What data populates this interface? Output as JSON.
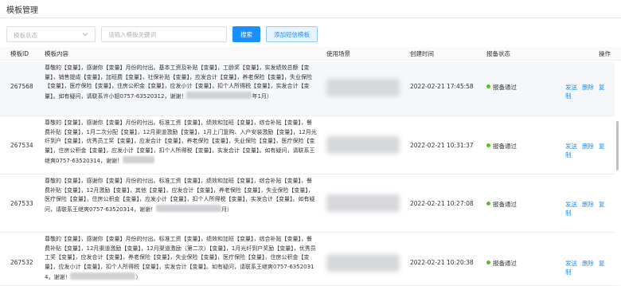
{
  "page_title": "模板管理",
  "toolbar": {
    "status_placeholder": "模板状态",
    "search_placeholder": "请输入模板关键词",
    "search_button": "搜索",
    "add_button": "添加短信模板"
  },
  "table": {
    "headers": [
      "模板ID",
      "模板内容",
      "使用场景",
      "创建时间",
      "报备状态",
      "操作"
    ],
    "rows": [
      {
        "id": "267568",
        "content_parts": [
          "尊敬的【变量】，感谢你【变量】月份的付出。基本工资及补贴【变量】，工龄奖【变量】，实发绩效总额【变量】，销售提成【变量】，加班费【变量】，社保补贴【变量】，应发合计【变量】，养老保险【变量】，失业保险【变量】，医疗保险【变量】，住房公积金【变量】，应发小计【变量】，扣个人所得税【变量】，实发合计【变量】。如有疑问，请联系许小姐0757-63520312，谢谢！",
          "年1月）"
        ],
        "time": "2022-02-21 17:45:58",
        "status": "报备通过"
      },
      {
        "id": "267534",
        "content_parts": [
          "尊敬的【变量】，感谢你【变量】月份的付出。标准工资【变量】，绩效和加班【变量】，综合补贴【变量】，餐费补贴【变量】，1月二次分配【变量】，12月渠道激励【变量】，1月上门复购、入户安装激励【变量】，12月光纤到户【变量】，优秀员工奖【变量】，应发合计【变量】，养老保险【变量】，失业保险【变量】，医疗保险【变量】，住房公积金【变量】，应发小计【变量】，扣个人所得税【变量】，实发合计【变量】。如有疑问，请联系王继爽0757-63520314，谢谢！",
          ""
        ],
        "time": "2022-02-21 10:31:37",
        "status": "报备通过"
      },
      {
        "id": "267533",
        "content_parts": [
          "尊敬的【变量】，感谢你【变量】月份的付出。标准工资【变量】，绩效和加班【变量】，综合补贴【变量】，餐费补贴【变量】，12月激励【变量】，其他【变量】，应发合计【变量】，养老保险【变量】，失业保险【变量】，医疗保险【变量】，住房公积金【变量】，应发小计【变量】，扣个人所得税【变量】，实发合计【变量】。如有疑问，请联系王继爽0757-63520314，谢谢！",
          "月）"
        ],
        "time": "2022-02-21 10:27:08",
        "status": "报备通过"
      },
      {
        "id": "267532",
        "content_parts": [
          "尊敬的【变量】，感谢你【变量】月份的付出。标准工资【变量】，绩效和加班【变量】，综合补贴【变量】，餐费补贴【变量】，12月渠道激励【变量】，12月渠道激励（第二次）【变量】，1月光纤到户奖励【变量】，优秀员工奖【变量】，应发合计【变量】，养老保险【变量】，失业保险【变量】，医疗保险【变量】，住房公积金【变量】，应发小计【变量】，扣个人所得税【变量】，实发合计【变量】。如有疑问，请联系王继爽0757-63520314，谢谢！",
          "）"
        ],
        "time": "2022-02-21 10:20:38",
        "status": "报备通过"
      }
    ],
    "actions": [
      "发送",
      "删除",
      "复制"
    ]
  }
}
